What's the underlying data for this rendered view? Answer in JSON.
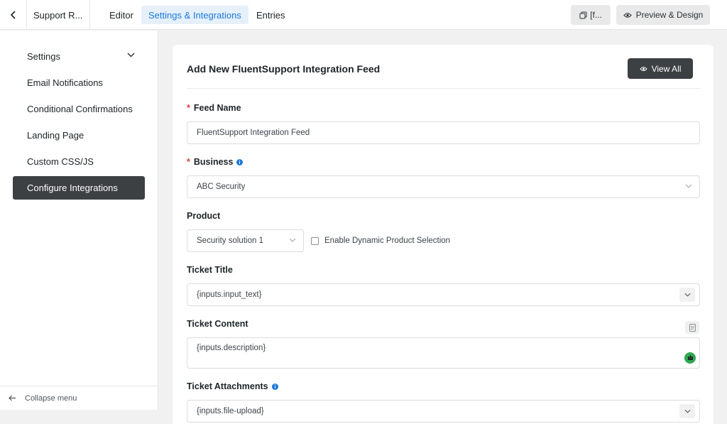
{
  "topbar": {
    "form_name": "Support R...",
    "tabs": [
      {
        "label": "Editor"
      },
      {
        "label": "Settings & Integrations"
      },
      {
        "label": "Entries"
      }
    ],
    "shortcode_label": "[f...",
    "preview_label": "Preview & Design"
  },
  "sidebar": {
    "items": [
      {
        "label": "Settings"
      },
      {
        "label": "Email Notifications"
      },
      {
        "label": "Conditional Confirmations"
      },
      {
        "label": "Landing Page"
      },
      {
        "label": "Custom CSS/JS"
      },
      {
        "label": "Configure Integrations"
      }
    ],
    "active_index": 5,
    "collapse_label": "Collapse menu"
  },
  "main": {
    "title": "Add New FluentSupport Integration Feed",
    "view_all_label": "View All",
    "feed_name": {
      "label": "Feed Name",
      "value": "FluentSupport Integration Feed"
    },
    "business": {
      "label": "Business",
      "value": "ABC Security"
    },
    "product": {
      "label": "Product",
      "value": "Security solution 1",
      "dynamic_label": "Enable Dynamic Product Selection"
    },
    "ticket_title": {
      "label": "Ticket Title",
      "value": "{inputs.input_text}"
    },
    "ticket_content": {
      "label": "Ticket Content",
      "value": "{inputs.description}"
    },
    "ticket_attachments": {
      "label": "Ticket Attachments",
      "value": "{inputs.file-upload}"
    }
  },
  "colors": {
    "accent": "#1a7ad9",
    "active_dark": "#3c4043",
    "required": "#e23c3c",
    "robot_green": "#2fa84f"
  },
  "icons": [
    "chevron-left-icon",
    "copy-icon",
    "eye-icon",
    "chevron-down-icon",
    "arrow-left-icon",
    "info-icon",
    "document-icon",
    "robot-icon"
  ]
}
